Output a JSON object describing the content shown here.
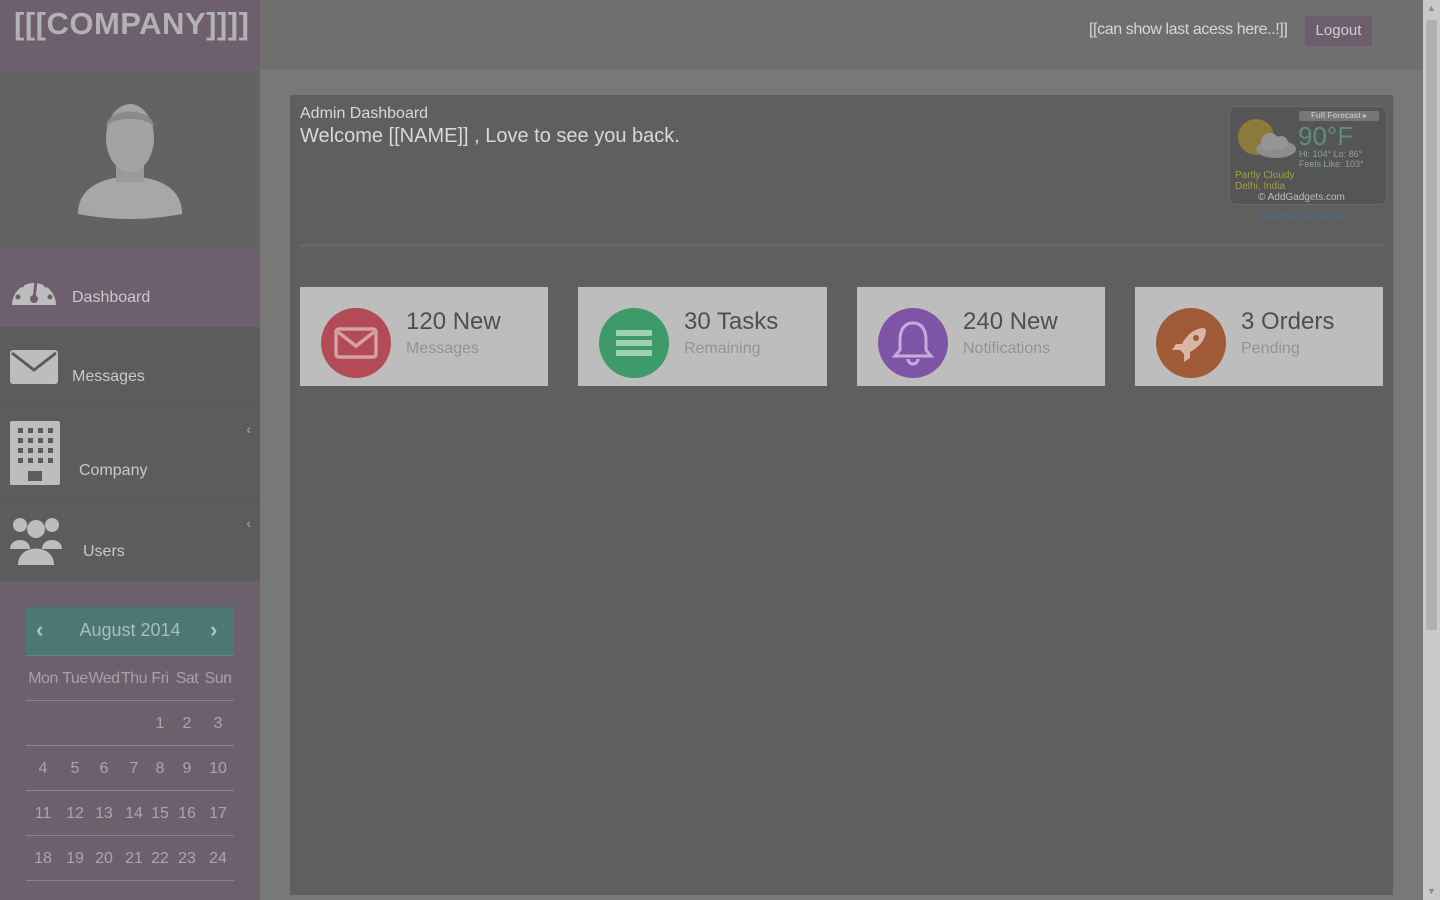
{
  "header": {
    "brand": "[[[COMPANY]]]]",
    "last_access": "[[can show last acess here..!]]",
    "logout_label": "Logout"
  },
  "sidebar": {
    "items": [
      {
        "label": "Dashboard",
        "icon": "dashboard-gauge-icon",
        "active": true
      },
      {
        "label": "Messages",
        "icon": "envelope-icon"
      },
      {
        "label": "Company",
        "icon": "building-icon",
        "has_submenu": true
      },
      {
        "label": "Users",
        "icon": "users-icon",
        "has_submenu": true
      }
    ]
  },
  "calendar": {
    "title": "August 2014",
    "prev": "‹",
    "next": "›",
    "weekdays": [
      "Mon",
      "Tue",
      "Wed",
      "Thu",
      "Fri",
      "Sat",
      "Sun"
    ],
    "weeks": [
      [
        "",
        "",
        "",
        "",
        "1",
        "2",
        "3"
      ],
      [
        "4",
        "5",
        "6",
        "7",
        "8",
        "9",
        "10"
      ],
      [
        "11",
        "12",
        "13",
        "14",
        "15",
        "16",
        "17"
      ],
      [
        "18",
        "19",
        "20",
        "21",
        "22",
        "23",
        "24"
      ]
    ]
  },
  "main": {
    "title": "Admin Dashboard",
    "welcome": "Welcome [[NAME]] , Love to see you back."
  },
  "weather": {
    "badge": "Full Forecast ▸",
    "temp": "90°F",
    "hilo": "Hi: 104° Lo: 86°",
    "feels": "Feels Like: 103°",
    "condition": "Partly Cloudy",
    "location": "Delhi, India",
    "copyright": "© AddGadgets.com",
    "link": "Weather Forecast"
  },
  "cards": [
    {
      "headline": "120 New",
      "sub": "Messages",
      "icon": "envelope-icon",
      "color": "#b34b57"
    },
    {
      "headline": "30 Tasks",
      "sub": "Remaining",
      "icon": "list-icon",
      "color": "#3f9a6a"
    },
    {
      "headline": "240 New",
      "sub": "Notifications",
      "icon": "bell-icon",
      "color": "#7e55a6"
    },
    {
      "headline": "3 Orders",
      "sub": "Pending",
      "icon": "rocket-icon",
      "color": "#a05a37"
    }
  ]
}
